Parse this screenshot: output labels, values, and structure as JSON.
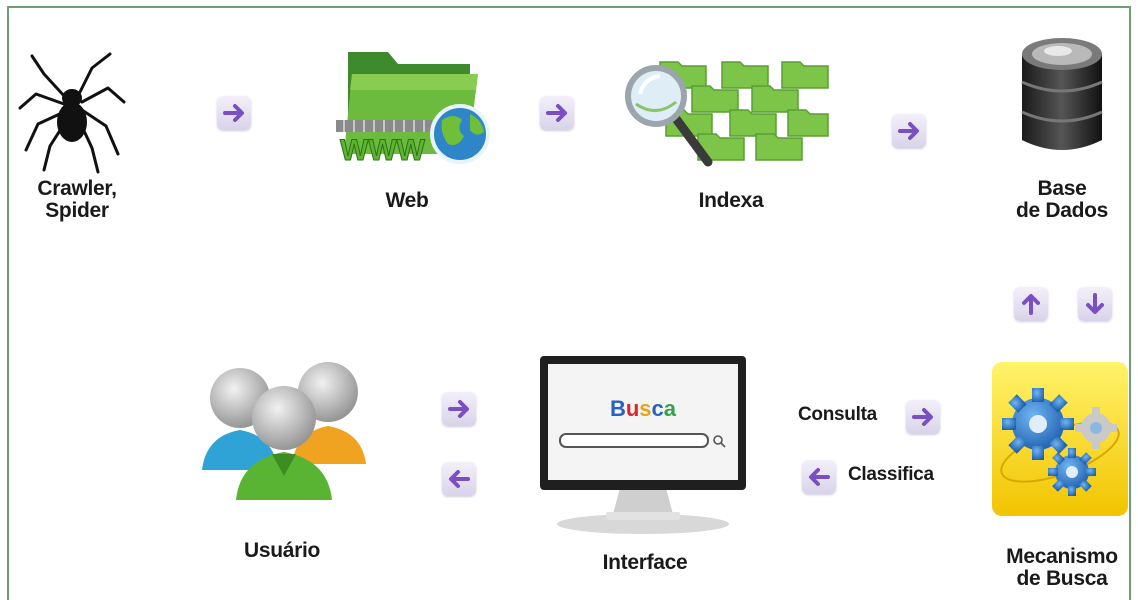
{
  "nodes": {
    "crawler": "Crawler,\nSpider",
    "web": "Web",
    "indexa": "Indexa",
    "base_dados": "Base\nde Dados",
    "mecanismo": "Mecanismo\nde Busca",
    "interface": "Interface",
    "usuario": "Usuário"
  },
  "screen": {
    "logo_letters": [
      "B",
      "u",
      "s",
      "c",
      "a"
    ],
    "logo_colors": [
      "#2a5fc4",
      "#d8262b",
      "#e7a11a",
      "#2a5fc4",
      "#38a04a"
    ]
  },
  "web_icon_text": "WWW",
  "edges": {
    "consulta": "Consulta",
    "classifica": "Classifica"
  },
  "colors": {
    "frame_border": "#6f9e72",
    "arrow_purple": "#7a4fc0",
    "arrow_bg": "#e3ddf0"
  }
}
